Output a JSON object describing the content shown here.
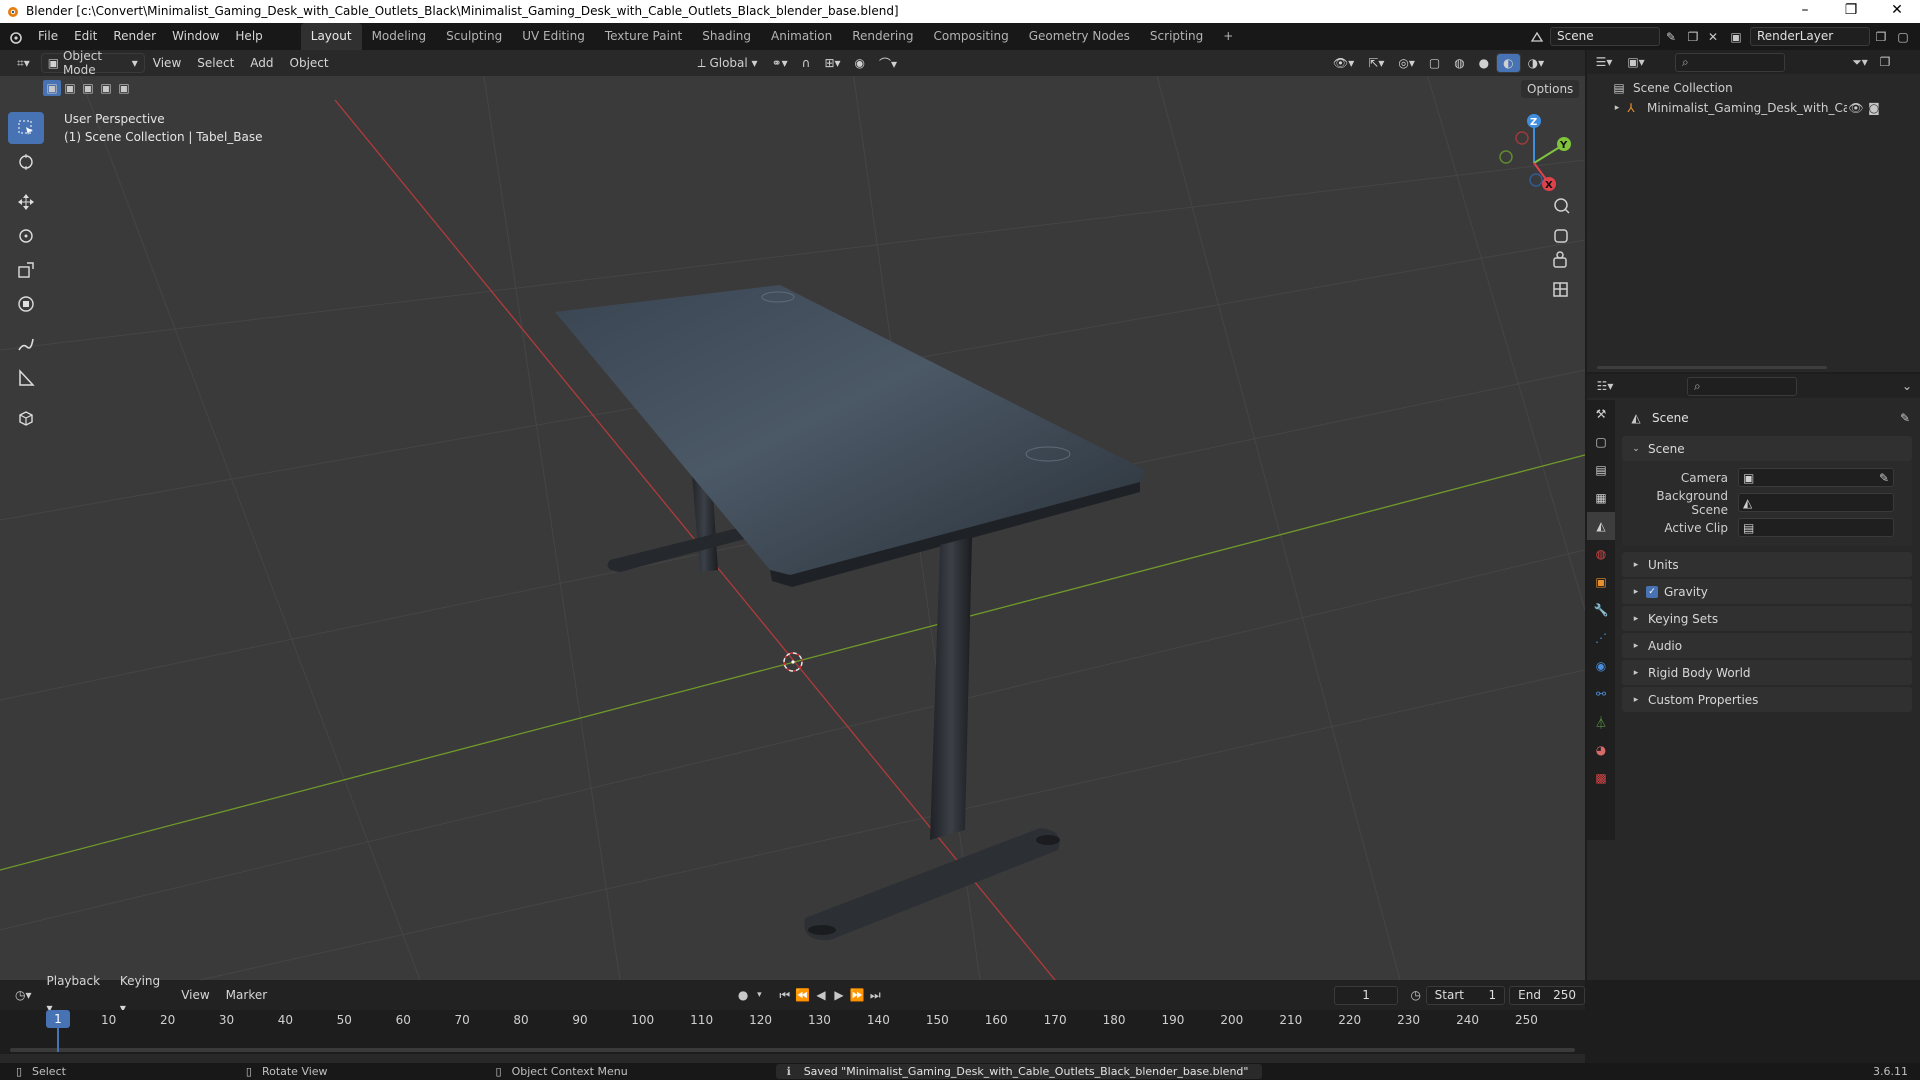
{
  "window": {
    "title": "Blender [c:\\Convert\\Minimalist_Gaming_Desk_with_Cable_Outlets_Black\\Minimalist_Gaming_Desk_with_Cable_Outlets_Black_blender_base.blend]",
    "minimize": "–",
    "maximize": "❐",
    "close": "✕"
  },
  "menubar": [
    "File",
    "Edit",
    "Render",
    "Window",
    "Help"
  ],
  "workspaces": [
    "Layout",
    "Modeling",
    "Sculpting",
    "UV Editing",
    "Texture Paint",
    "Shading",
    "Animation",
    "Rendering",
    "Compositing",
    "Geometry Nodes",
    "Scripting"
  ],
  "add_workspace": "+",
  "scene_field": "Scene",
  "renderlayer_field": "RenderLayer",
  "viewport": {
    "mode": "Object Mode",
    "menus": [
      "View",
      "Select",
      "Add",
      "Object"
    ],
    "transform": "Global",
    "options": "Options",
    "overlay_line1": "User Perspective",
    "overlay_line2": "(1) Scene Collection | Tabel_Base",
    "axes": {
      "x": "X",
      "y": "Y",
      "z": "Z"
    }
  },
  "outliner": {
    "root": "Scene Collection",
    "item": "Minimalist_Gaming_Desk_with_Cable_C"
  },
  "properties": {
    "header": "Scene",
    "section": "Scene",
    "camera_label": "Camera",
    "bg_scene_label": "Background Scene",
    "active_clip_label": "Active Clip",
    "panels": [
      "Units",
      "Gravity",
      "Keying Sets",
      "Audio",
      "Rigid Body World",
      "Custom Properties"
    ]
  },
  "timeline": {
    "menus": [
      "Playback",
      "Keying",
      "View",
      "Marker"
    ],
    "current_frame": "1",
    "start_label": "Start",
    "start": "1",
    "end_label": "End",
    "end": "250",
    "ticks": [
      "1",
      "10",
      "20",
      "30",
      "40",
      "50",
      "60",
      "70",
      "80",
      "90",
      "100",
      "110",
      "120",
      "130",
      "140",
      "150",
      "160",
      "170",
      "180",
      "190",
      "200",
      "210",
      "220",
      "230",
      "240",
      "250"
    ]
  },
  "statusbar": {
    "select": "Select",
    "rotate": "Rotate View",
    "context": "Object Context Menu",
    "message": "Saved \"Minimalist_Gaming_Desk_with_Cable_Outlets_Black_blender_base.blend\"",
    "version": "3.6.11"
  },
  "colors": {
    "accent": "#4772b3",
    "x_axis": "#e0424b",
    "y_axis": "#7fc43a",
    "z_axis": "#3f8ee0",
    "viewport_bg": "#3a3a3a"
  }
}
